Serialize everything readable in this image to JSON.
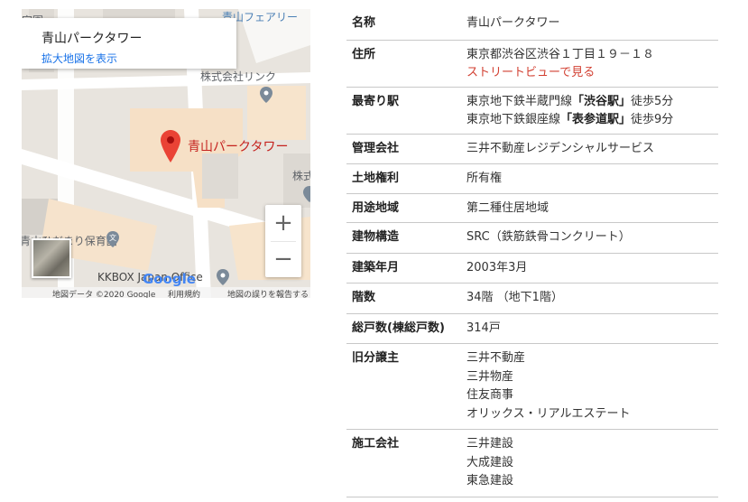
{
  "map": {
    "place_card": {
      "name": "青山パークタワー",
      "link": "拡大地図を表示"
    },
    "labels": {
      "top_left": "家園",
      "top_right": "青山フェアリー",
      "company": "株式会社リンク",
      "kabu": "株式",
      "marker": "青山パークタワー",
      "nursery": "青山ひだまり保育園",
      "kkbox": "KKBOX Japan Office"
    },
    "zoom_in": "+",
    "zoom_out": "−",
    "logo": "Google",
    "attribution": {
      "data": "地図データ ©2020 Google",
      "terms": "利用規約",
      "report": "地図の誤りを報告する"
    }
  },
  "info_table": {
    "rows": [
      {
        "key": "名称",
        "lines": [
          "青山パークタワー"
        ]
      },
      {
        "key": "住所",
        "lines": [
          "東京都渋谷区渋谷１丁目１９－１８"
        ],
        "link": "ストリートビューで見る"
      },
      {
        "key": "最寄り駅",
        "stations": [
          {
            "pre": "東京地下鉄半蔵門線",
            "name": "「渋谷駅」",
            "post": "徒歩5分"
          },
          {
            "pre": "東京地下鉄銀座線",
            "name": "「表参道駅」",
            "post": "徒歩9分"
          }
        ]
      },
      {
        "key": "管理会社",
        "lines": [
          "三井不動産レジデンシャルサービス"
        ]
      },
      {
        "key": "土地権利",
        "lines": [
          "所有権"
        ]
      },
      {
        "key": "用途地域",
        "lines": [
          "第二種住居地域"
        ]
      },
      {
        "key": "建物構造",
        "lines": [
          "SRC（鉄筋鉄骨コンクリート）"
        ]
      },
      {
        "key": "建築年月",
        "lines": [
          "2003年3月"
        ]
      },
      {
        "key": "階数",
        "lines": [
          "34階 （地下1階）"
        ]
      },
      {
        "key": "総戸数(棟総戸数)",
        "lines": [
          "314戸"
        ]
      },
      {
        "key": "旧分譲主",
        "lines": [
          "三井不動産",
          "三井物産",
          "住友商事",
          "オリックス・リアルエステート"
        ]
      },
      {
        "key": "施工会社",
        "lines": [
          "三井建設",
          "大成建設",
          "東急建設"
        ]
      }
    ]
  },
  "colors": {
    "marker_red": "#ea4335",
    "link_blue": "#1a73e8",
    "street_red": "#d23f31"
  }
}
